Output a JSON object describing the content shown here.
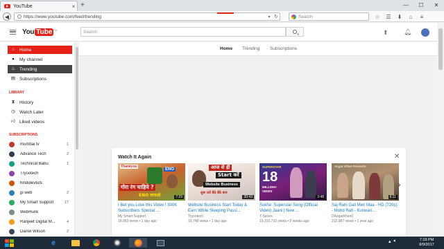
{
  "browser": {
    "tab_title": "YouTube",
    "tab_close": "×",
    "new_tab": "+",
    "url": "https://www.youtube.com/feed/trending",
    "search_placeholder": "Search",
    "window_buttons": [
      "—",
      "☐",
      "✕"
    ],
    "toolbar_icons": [
      "star-icon",
      "list-icon",
      "download-icon",
      "home-icon",
      "menu-icon"
    ]
  },
  "masthead": {
    "logo_you": "You",
    "logo_tube": "Tube",
    "logo_region": "IN",
    "search_placeholder": "Search"
  },
  "sidebar": {
    "nav": [
      {
        "label": "Home",
        "icon": "home-icon",
        "state": "active"
      },
      {
        "label": "My channel",
        "icon": "person-icon",
        "state": ""
      },
      {
        "label": "Trending",
        "icon": "flame-icon",
        "state": "hover"
      },
      {
        "label": "Subscriptions",
        "icon": "subscriptions-icon",
        "state": ""
      }
    ],
    "library_heading": "LIBRARY",
    "library": [
      {
        "label": "History",
        "icon": "history-icon"
      },
      {
        "label": "Watch Later",
        "icon": "clock-icon"
      },
      {
        "label": "Liked videos",
        "icon": "thumb-up-icon"
      }
    ],
    "subscriptions_heading": "SUBSCRIPTIONS",
    "subscriptions": [
      {
        "name": "mumbai tv",
        "count": "1",
        "color": "#c0392b"
      },
      {
        "name": "Advance Tech",
        "count": "2",
        "color": "#2c3e50"
      },
      {
        "name": "Technical Babu",
        "count": "1",
        "color": "#16a085"
      },
      {
        "name": "Tryootech",
        "count": "",
        "color": "#8e44ad"
      },
      {
        "name": "hindidevtuts",
        "count": "",
        "color": "#d35400"
      },
      {
        "name": "jp web",
        "count": "2",
        "color": "#2980b9"
      },
      {
        "name": "My Smart Support",
        "count": "17",
        "color": "#27ae60"
      },
      {
        "name": "WebHunk",
        "count": "",
        "color": "#7f8c8d"
      },
      {
        "name": "Ranjeet Digital M...",
        "count": "4",
        "color": "#f39c12"
      },
      {
        "name": "Darrel Wilson",
        "count": "2",
        "color": "#34495e"
      }
    ]
  },
  "main": {
    "tabs": [
      "Home",
      "Trending",
      "Subscriptions"
    ],
    "active_tab": "Home",
    "card_title": "Watch It Again",
    "card_close": "✕",
    "videos": [
      {
        "title": "I Bet you Love this Video ! 300K Subscribers Special ...",
        "channel": "My Smart Support",
        "meta": "16,053 views • 1 day ago",
        "duration": "7:29"
      },
      {
        "title": "Website Business Start Today & Earn While Sleeping Passi...",
        "channel": "Tryootech",
        "meta": "19,748 views • 1 day ago",
        "duration": "30:43"
      },
      {
        "title": "Sukhe: Superstar Song (Official Video) Jaani | New ...",
        "channel": "T-Series",
        "meta": "19,310,733 views • 2 weeks ago",
        "duration": "3:48"
      },
      {
        "title": "Saj Rahi Gali Meri Maa - HD (720p) - Mohd Rafi - Kunwari...",
        "channel": "DAzgarKhan0",
        "meta": "212,987 views • 1 year ago",
        "duration": "6:11"
      }
    ],
    "thumb_texts": {
      "t1_top": "Thankyou",
      "t1_line": "गोरा रंग चाहिये ?",
      "t1_sub": "ENO लगाओ",
      "t1_tag": "ENO",
      "t2_top": "आज से ही",
      "t2_mid": "Start करें",
      "t2_box": "Website Business",
      "t2_bot": "शुरू करें बैठे बैठे कम",
      "t3_label": "SUPERSTAR",
      "t3_num": "18",
      "t3_sub": "MILLION+ VIEWS",
      "t4_top": "Asgar Khan Presents"
    }
  },
  "taskbar": {
    "time": "7:19 PM",
    "date": "8/9/2017"
  }
}
